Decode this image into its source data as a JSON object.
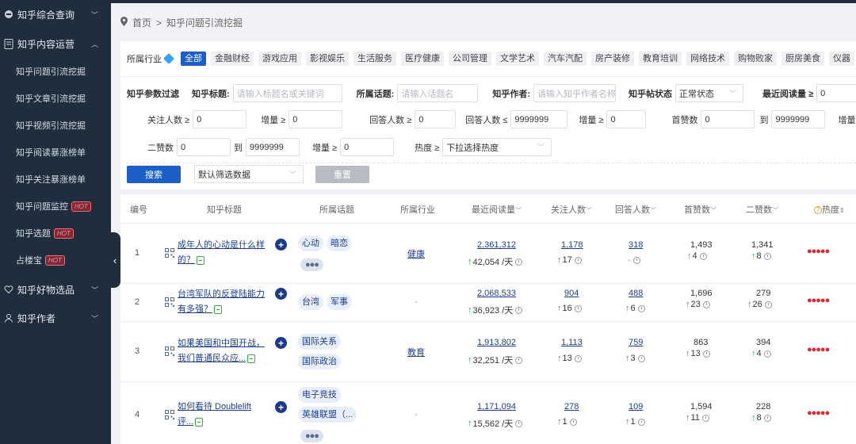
{
  "sidebar": {
    "groups": [
      {
        "label": "知乎综合查询",
        "icon": "globe-icon"
      },
      {
        "label": "知乎内容运营",
        "icon": "document-icon"
      },
      {
        "label": "知乎好物选品",
        "icon": "heart-icon"
      },
      {
        "label": "知乎作者",
        "icon": "user-icon"
      }
    ],
    "items": [
      {
        "label": "知乎问题引流挖掘"
      },
      {
        "label": "知乎文章引流挖掘"
      },
      {
        "label": "知乎视频引流挖掘"
      },
      {
        "label": "知乎阅读暴涨榜单"
      },
      {
        "label": "知乎关注暴涨榜单"
      },
      {
        "label": "知乎问题监控",
        "badge": "HOT"
      },
      {
        "label": "知乎选题",
        "badge": "HOT"
      },
      {
        "label": "占楼宝",
        "badge": "HOT"
      }
    ]
  },
  "breadcrumb": {
    "home": "首页",
    "sep": ">",
    "current": "知乎问题引流挖掘"
  },
  "industry": {
    "label": "所属行业",
    "tags": [
      "全部",
      "金融财经",
      "游戏应用",
      "影视娱乐",
      "生活服务",
      "医疗健康",
      "公司管理",
      "文学艺术",
      "汽车汽配",
      "房产装修",
      "教育培训",
      "网络技术",
      "购物败家",
      "厨房美食",
      "仪器"
    ]
  },
  "filters": {
    "section_label": "知乎参数过滤",
    "title_label": "知乎标题:",
    "title_placeholder": "请输入标题名或关键词",
    "topic_label": "所属话题:",
    "topic_placeholder": "请输入话题名",
    "author_label": "知乎作者:",
    "author_placeholder": "请输入知乎作者名称",
    "status_label": "知乎帖状态",
    "status_value": "正常状态",
    "recent_read_label": "最近阅读量 ≥",
    "recent_read_value": "0",
    "followers_label": "关注人数 ≥",
    "followers_value": "0",
    "inc1_label": "增量 ≥",
    "inc1_value": "0",
    "answers_min_label": "回答人数 ≥",
    "answers_min_value": "0",
    "answers_max_label": "回答人数 ≤",
    "answers_max_value": "9999999",
    "inc2_label": "增量 ≥",
    "inc2_value": "0",
    "first_likes_label": "首赞数",
    "first_likes_min": "0",
    "to_label": "到",
    "first_likes_max": "9999999",
    "inc3_label": "增量 ≥",
    "second_likes_label": "二赞数",
    "second_likes_min": "0",
    "to_label2": "到",
    "second_likes_max": "9999999",
    "inc4_label": "增量 ≥",
    "inc4_value": "0",
    "heat_label": "热度 ≥",
    "heat_placeholder": "下拉选择热度"
  },
  "actions": {
    "search": "搜索",
    "preset_value": "默认筛选数据",
    "reset": "重置"
  },
  "table": {
    "headers": [
      "编号",
      "知乎标题",
      "所属话题",
      "所属行业",
      "最近阅读量",
      "关注人数",
      "回答人数",
      "首赞数",
      "二赞数",
      "热度"
    ],
    "rows": [
      {
        "no": "1",
        "title1": "成年人的心动是什么样",
        "title2": "的？",
        "topics": [
          "心动",
          "暗恋"
        ],
        "more": "●●●",
        "industry": "健康",
        "reads": "2,361,312",
        "reads_inc": "42,054 /天",
        "follow": "1,178",
        "follow_inc": "17",
        "answers": "318",
        "answers_inc": "-",
        "first": "1,493",
        "first_inc": "4",
        "second": "1,341",
        "second_inc": "8",
        "heat": "●●●●●"
      },
      {
        "no": "2",
        "title1": "台湾军队的反登陆能力",
        "title2": "有多强？",
        "topics": [
          "台湾",
          "军事"
        ],
        "more": "",
        "industry": "-",
        "reads": "2,068,533",
        "reads_inc": "36,923 /天",
        "follow": "904",
        "follow_inc": "16",
        "answers": "488",
        "answers_inc": "6",
        "first": "1,696",
        "first_inc": "23",
        "second": "279",
        "second_inc": "26",
        "heat": "●●●●●"
      },
      {
        "no": "3",
        "title1": "如果美国和中国开战，",
        "title2": "我们普通民众应...",
        "topics": [
          "国际关系",
          "国际政治"
        ],
        "more": "",
        "industry": "教育",
        "reads": "1,913,802",
        "reads_inc": "32,251 /天",
        "follow": "1,113",
        "follow_inc": "13",
        "answers": "759",
        "answers_inc": "3",
        "first": "863",
        "first_inc": "13",
        "second": "394",
        "second_inc": "4",
        "heat": "●●●●●"
      },
      {
        "no": "4",
        "title1": "如何看待 Doublelift",
        "title2": "评...",
        "topics": [
          "电子竞技",
          "英雄联盟（..."
        ],
        "more": "●●●",
        "industry": "-",
        "reads": "1,171,094",
        "reads_inc": "15,562 /天",
        "follow": "278",
        "follow_inc": "1",
        "answers": "109",
        "answers_inc": "1",
        "first": "1,594",
        "first_inc": "11",
        "second": "228",
        "second_inc": "8",
        "heat": "●●●●●"
      }
    ]
  }
}
